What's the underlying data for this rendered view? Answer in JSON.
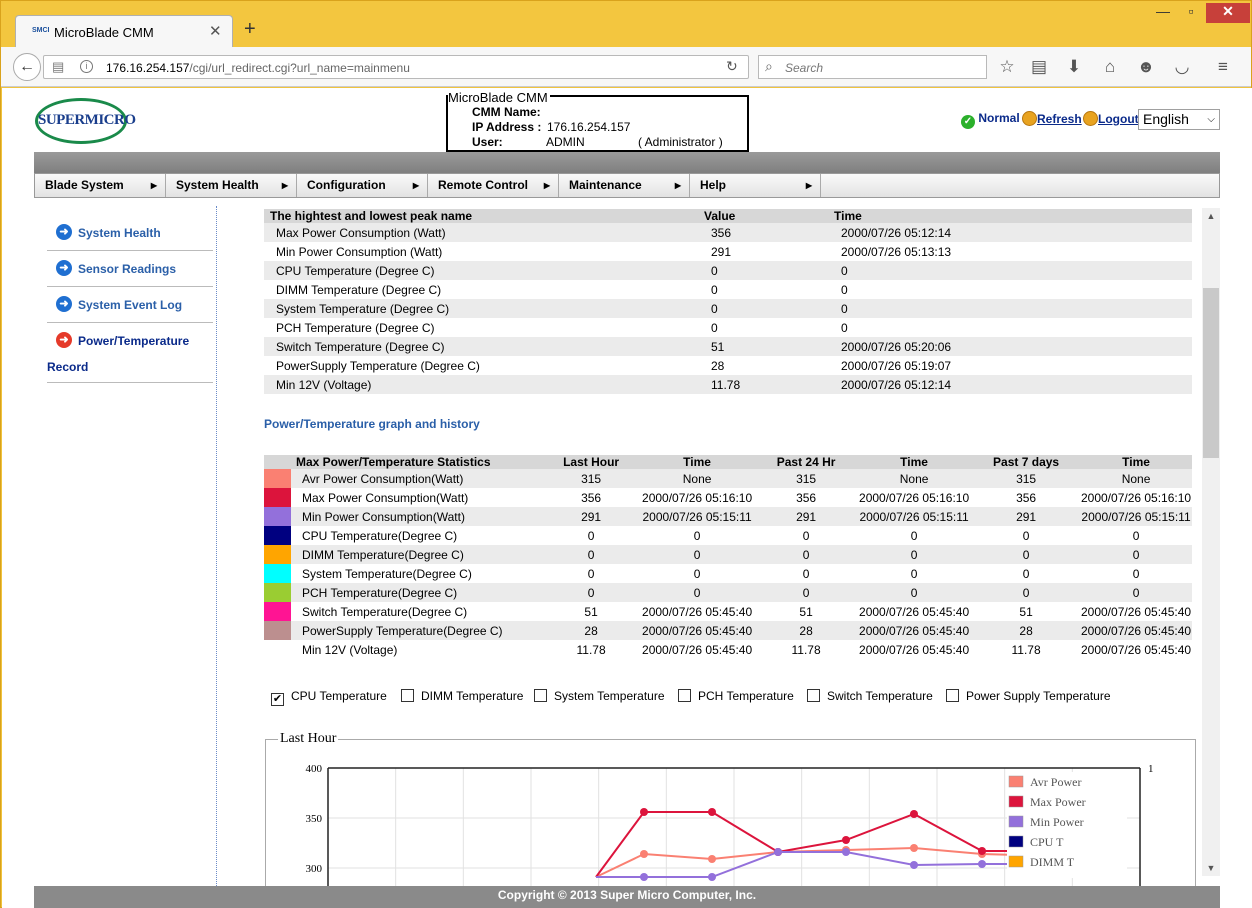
{
  "browser": {
    "tab_title": "MicroBlade CMM",
    "tab_favicon": "SMCI",
    "url_host": "176.16.254.157",
    "url_path": "/cgi/url_redirect.cgi?url_name=mainmenu",
    "search_placeholder": "Search"
  },
  "header": {
    "logo_text": "SUPERMICRO",
    "info_title": "MicroBlade CMM",
    "cmm_name_label": "CMM Name:",
    "ip_label": "IP Address :",
    "ip_value": "176.16.254.157",
    "user_label": "User:",
    "user_value": "ADMIN",
    "user_role": "( Administrator )",
    "status_text": "Normal",
    "refresh_text": "Refresh",
    "logout_text": "Logout",
    "language": "English"
  },
  "menu": [
    {
      "label": "Blade System"
    },
    {
      "label": "System Health"
    },
    {
      "label": "Configuration"
    },
    {
      "label": "Remote Control"
    },
    {
      "label": "Maintenance"
    },
    {
      "label": "Help"
    }
  ],
  "sidebar": [
    {
      "label": "System Health"
    },
    {
      "label": "Sensor Readings"
    },
    {
      "label": "System Event Log"
    },
    {
      "label": "Power/Temperature",
      "label2": "Record"
    }
  ],
  "peak_table": {
    "headers": [
      "The hightest and lowest peak name",
      "Value",
      "Time"
    ],
    "rows": [
      [
        "Max Power Consumption (Watt)",
        "356",
        "2000/07/26 05:12:14"
      ],
      [
        "Min Power Consumption (Watt)",
        "291",
        "2000/07/26 05:13:13"
      ],
      [
        "CPU Temperature (Degree C)",
        "0",
        "0"
      ],
      [
        "DIMM Temperature (Degree C)",
        "0",
        "0"
      ],
      [
        "System Temperature (Degree C)",
        "0",
        "0"
      ],
      [
        "PCH Temperature (Degree C)",
        "0",
        "0"
      ],
      [
        "Switch Temperature (Degree C)",
        "51",
        "2000/07/26 05:20:06"
      ],
      [
        "PowerSupply Temperature (Degree C)",
        "28",
        "2000/07/26 05:19:07"
      ],
      [
        "Min 12V (Voltage)",
        "11.78",
        "2000/07/26 05:12:14"
      ]
    ]
  },
  "graph_section_title": "Power/Temperature graph and history",
  "stats_table": {
    "headers": [
      "Max Power/Temperature Statistics",
      "Last Hour",
      "Time",
      "Past 24 Hr",
      "Time",
      "Past 7 days",
      "Time"
    ],
    "rows": [
      {
        "color": "#fa8072",
        "cells": [
          "Avr Power Consumption(Watt)",
          "315",
          "None",
          "315",
          "None",
          "315",
          "None"
        ]
      },
      {
        "color": "#dc143c",
        "cells": [
          "Max Power Consumption(Watt)",
          "356",
          "2000/07/26 05:16:10",
          "356",
          "2000/07/26 05:16:10",
          "356",
          "2000/07/26 05:16:10"
        ]
      },
      {
        "color": "#9370db",
        "cells": [
          "Min Power Consumption(Watt)",
          "291",
          "2000/07/26 05:15:11",
          "291",
          "2000/07/26 05:15:11",
          "291",
          "2000/07/26 05:15:11"
        ]
      },
      {
        "color": "#000080",
        "cells": [
          "CPU Temperature(Degree C)",
          "0",
          "0",
          "0",
          "0",
          "0",
          "0"
        ]
      },
      {
        "color": "#ffa500",
        "cells": [
          "DIMM Temperature(Degree C)",
          "0",
          "0",
          "0",
          "0",
          "0",
          "0"
        ]
      },
      {
        "color": "#00ffff",
        "cells": [
          "System Temperature(Degree C)",
          "0",
          "0",
          "0",
          "0",
          "0",
          "0"
        ]
      },
      {
        "color": "#9acd32",
        "cells": [
          "PCH Temperature(Degree C)",
          "0",
          "0",
          "0",
          "0",
          "0",
          "0"
        ]
      },
      {
        "color": "#ff1493",
        "cells": [
          "Switch Temperature(Degree C)",
          "51",
          "2000/07/26 05:45:40",
          "51",
          "2000/07/26 05:45:40",
          "51",
          "2000/07/26 05:45:40"
        ]
      },
      {
        "color": "#bc8f8f",
        "cells": [
          "PowerSupply Temperature(Degree C)",
          "28",
          "2000/07/26 05:45:40",
          "28",
          "2000/07/26 05:45:40",
          "28",
          "2000/07/26 05:45:40"
        ]
      },
      {
        "color": "",
        "cells": [
          "Min 12V (Voltage)",
          "11.78",
          "2000/07/26 05:45:40",
          "11.78",
          "2000/07/26 05:45:40",
          "11.78",
          "2000/07/26 05:45:40"
        ]
      }
    ]
  },
  "checkboxes": [
    {
      "label": "CPU Temperature",
      "checked": true
    },
    {
      "label": "DIMM Temperature",
      "checked": false
    },
    {
      "label": "System Temperature",
      "checked": false
    },
    {
      "label": "PCH Temperature",
      "checked": false
    },
    {
      "label": "Switch Temperature",
      "checked": false
    },
    {
      "label": "Power Supply Temperature",
      "checked": false
    }
  ],
  "chart_data": {
    "type": "line",
    "title": "Last Hour",
    "ylim": [
      300,
      400
    ],
    "yticks": [
      "400",
      "350",
      "300"
    ],
    "y2_tick": "1",
    "grid": true,
    "legend_position": "top-right",
    "series": [
      {
        "name": "Avr Power",
        "color": "#fa8072",
        "values": [
          291,
          314,
          309,
          316,
          318,
          320,
          314,
          312,
          315
        ]
      },
      {
        "name": "Max Power",
        "color": "#dc143c",
        "values": [
          291,
          356,
          356,
          316,
          328,
          354,
          317,
          317,
          317
        ]
      },
      {
        "name": "Min Power",
        "color": "#9370db",
        "values": [
          291,
          291,
          291,
          316,
          316,
          303,
          304,
          304,
          304
        ]
      },
      {
        "name": "CPU T",
        "color": "#000080",
        "values": []
      },
      {
        "name": "DIMM T",
        "color": "#ffa500",
        "values": []
      }
    ]
  },
  "footer": "Copyright © 2013 Super Micro Computer, Inc.",
  "colors": {
    "link": "#2a5fa8",
    "menu_bg": "#e6e6e6",
    "browser_chrome": "#f3c63f"
  }
}
